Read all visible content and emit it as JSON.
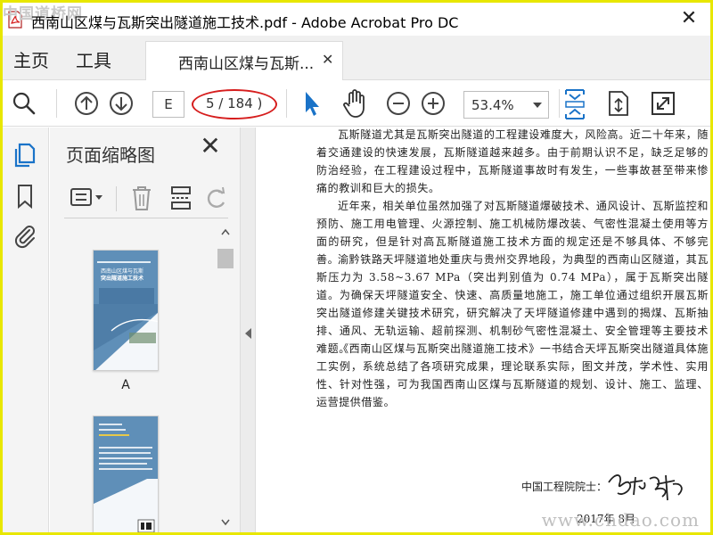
{
  "window": {
    "title": "西南山区煤与瓦斯突出隧道施工技术.pdf - Adobe Acrobat Pro DC",
    "close_label": "✕"
  },
  "watermark": {
    "top": "中国道桥网",
    "bottom": "www.chdao.com"
  },
  "menu": {
    "home_label": "主页",
    "tools_label": "工具"
  },
  "doc_tab": {
    "label": "西南山区煤与瓦斯...",
    "close_label": "✕"
  },
  "toolbar": {
    "page_input_value": "E",
    "page_count": "5 / 184 )",
    "zoom_value": "53.4%"
  },
  "thumbnail_panel": {
    "title": "页面缩略图",
    "close_label": "✕",
    "thumb_label": "A",
    "cover": {
      "title_line1": "西南山区煤与瓦斯",
      "title_line2": "突出隧道施工技术"
    }
  },
  "document": {
    "paragraphs": [
      "瓦斯隧道尤其是瓦斯突出隧道的工程建设难度大，风险高。近二十年来，随着交通建设的快速发展，瓦斯隧道越来越多。由于前期认识不足，缺乏足够的防治经验，在工程建设过程中，瓦斯隧道事故时有发生，一些事故甚至带来惨痛的教训和巨大的损失。",
      "近年来，相关单位虽然加强了对瓦斯隧道爆破技术、通风设计、瓦斯监控和预防、施工用电管理、火源控制、施工机械防爆改装、气密性混凝土使用等方面的研究，但是针对高瓦斯隧道施工技术方面的规定还是不够具体、不够完善。",
      "渝黔铁路天坪隧道地处重庆与贵州交界地段，为典型的西南山区隧道，其瓦斯压力为 3.58~3.67 MPa（突出判别值为 0.74 MPa），属于瓦斯突出隧道。为确保天坪隧道安全、快速、高质量地施工，施工单位通过组织开展瓦斯突出隧道修建关键技术研究，研究解决了天坪隧道修建中遇到的揭煤、瓦斯抽排、通风、无轨运输、超前探测、机制砂气密性混凝土、安全管理等主要技术难题。",
      "《西南山区煤与瓦斯突出隧道施工技术》一书结合天坪瓦斯突出隧道具体施工实例，系统总结了各项研究成果，理论联系实际，图文并茂，学术性、实用性、针对性强，可为我国西南山区煤与瓦斯隧道的规划、设计、施工、监理、运营提供借鉴。"
    ],
    "signature_label": "中国工程院院士：",
    "signature_name": "梁文灏",
    "date": "2017年 8月"
  },
  "colors": {
    "accent": "#1a73c8",
    "annotation": "#d61e1e",
    "outer_border": "#e8e700"
  }
}
